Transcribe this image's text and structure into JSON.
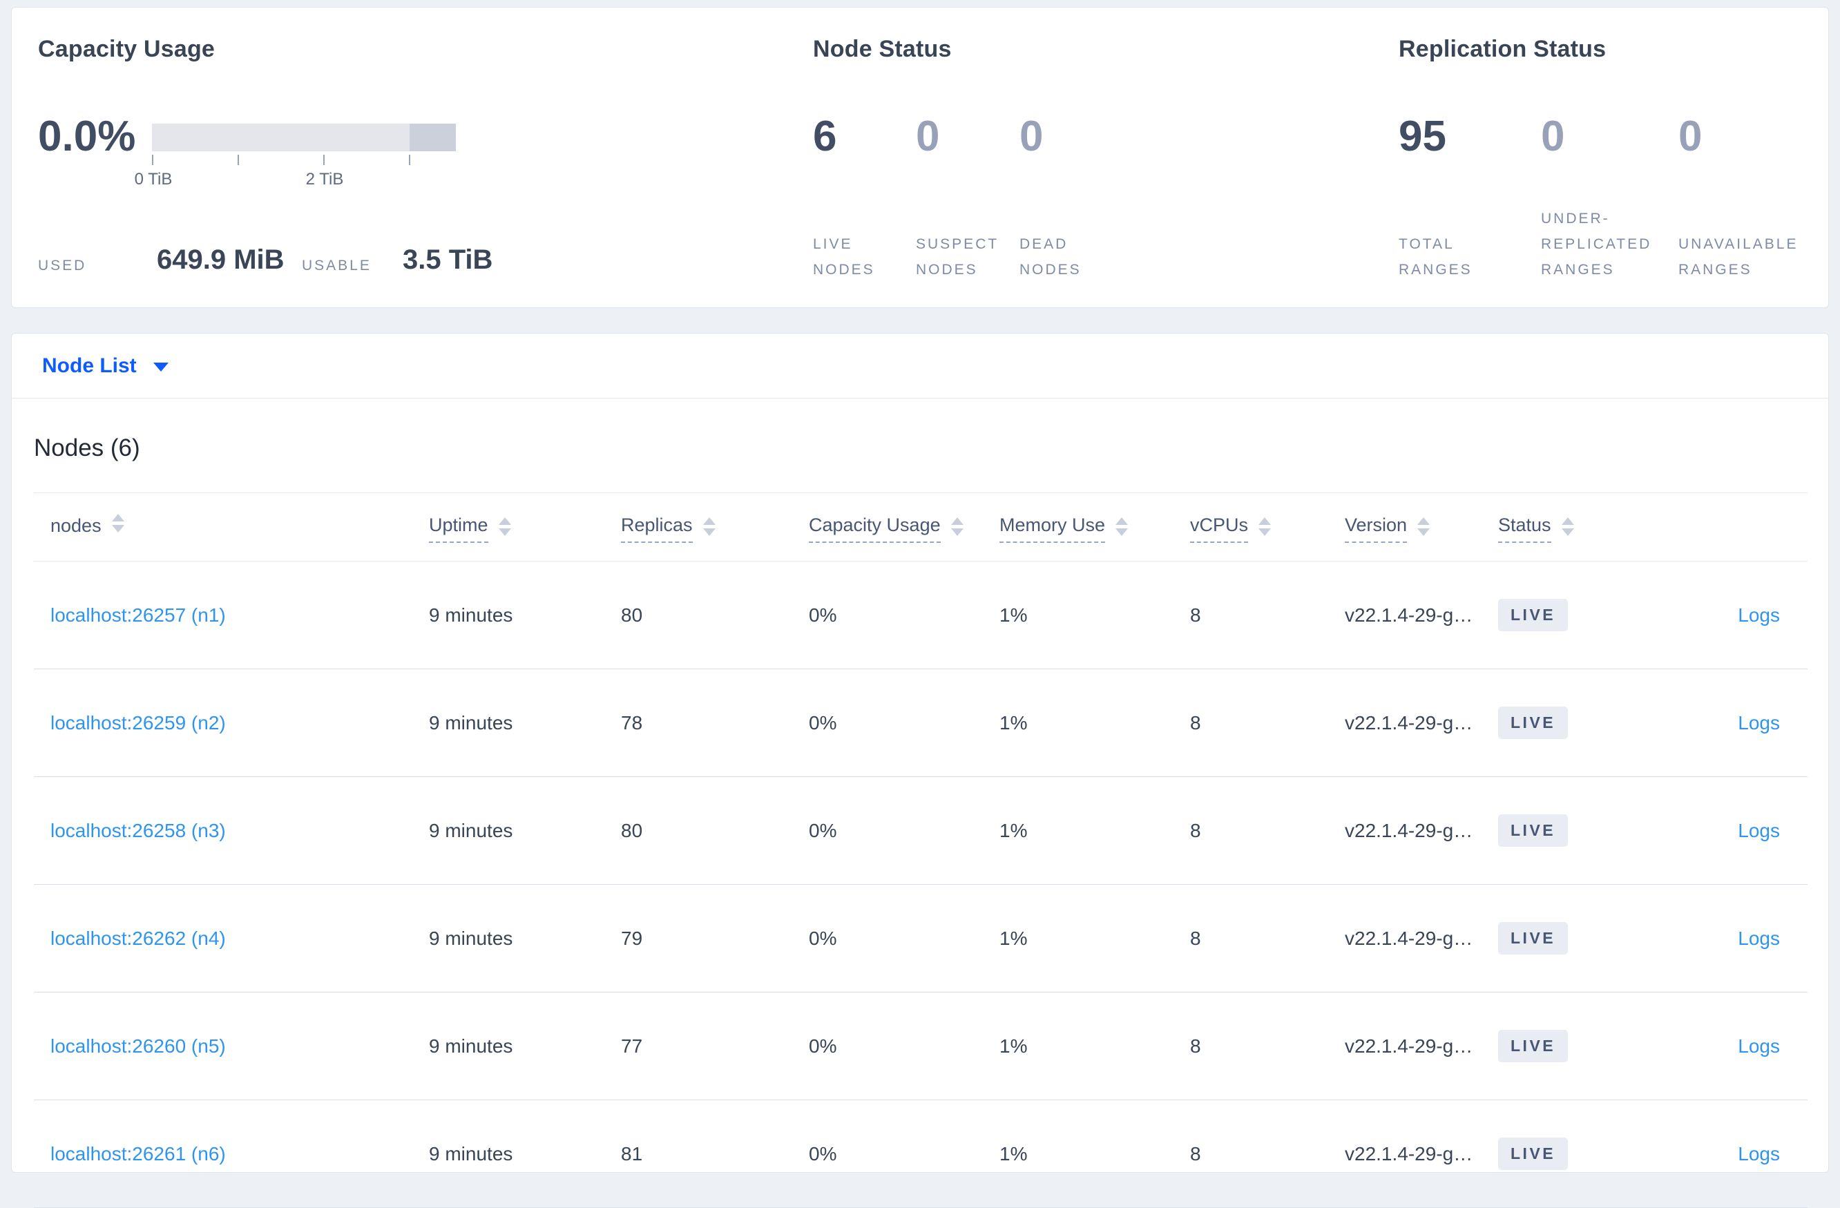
{
  "summary": {
    "capacity": {
      "title": "Capacity Usage",
      "percent": "0.0%",
      "bar": {
        "segments": [
          {
            "name": "usable",
            "fraction": 0.85,
            "color": "#e4e6eb"
          },
          {
            "name": "other",
            "fraction": 0.15,
            "color": "#cbd0db"
          }
        ],
        "tick_labels": [
          "0 TiB",
          "2 TiB"
        ]
      },
      "used_label": "USED",
      "used_value": "649.9 MiB",
      "usable_label": "USABLE",
      "usable_value": "3.5 TiB"
    },
    "node_status": {
      "title": "Node Status",
      "stats": [
        {
          "value": "6",
          "label": "LIVE NODES",
          "emphasis": true
        },
        {
          "value": "0",
          "label": "SUSPECT NODES",
          "emphasis": false
        },
        {
          "value": "0",
          "label": "DEAD NODES",
          "emphasis": false
        }
      ]
    },
    "replication_status": {
      "title": "Replication Status",
      "stats": [
        {
          "value": "95",
          "label": "TOTAL RANGES",
          "emphasis": true
        },
        {
          "value": "0",
          "label": "UNDER-REPLICATED RANGES",
          "emphasis": false
        },
        {
          "value": "0",
          "label": "UNAVAILABLE RANGES",
          "emphasis": false
        }
      ]
    }
  },
  "view_selector": {
    "label": "Node List"
  },
  "nodes_table": {
    "title": "Nodes (6)",
    "columns": [
      "nodes",
      "Uptime",
      "Replicas",
      "Capacity Usage",
      "Memory Use",
      "vCPUs",
      "Version",
      "Status"
    ],
    "rows": [
      {
        "address": "localhost:26257 (n1)",
        "uptime": "9 minutes",
        "replicas": "80",
        "capacity": "0%",
        "memory": "1%",
        "vcpus": "8",
        "version": "v22.1.4-29-g…",
        "status": "LIVE",
        "logs": "Logs"
      },
      {
        "address": "localhost:26259 (n2)",
        "uptime": "9 minutes",
        "replicas": "78",
        "capacity": "0%",
        "memory": "1%",
        "vcpus": "8",
        "version": "v22.1.4-29-g…",
        "status": "LIVE",
        "logs": "Logs"
      },
      {
        "address": "localhost:26258 (n3)",
        "uptime": "9 minutes",
        "replicas": "80",
        "capacity": "0%",
        "memory": "1%",
        "vcpus": "8",
        "version": "v22.1.4-29-g…",
        "status": "LIVE",
        "logs": "Logs"
      },
      {
        "address": "localhost:26262 (n4)",
        "uptime": "9 minutes",
        "replicas": "79",
        "capacity": "0%",
        "memory": "1%",
        "vcpus": "8",
        "version": "v22.1.4-29-g…",
        "status": "LIVE",
        "logs": "Logs"
      },
      {
        "address": "localhost:26260 (n5)",
        "uptime": "9 minutes",
        "replicas": "77",
        "capacity": "0%",
        "memory": "1%",
        "vcpus": "8",
        "version": "v22.1.4-29-g…",
        "status": "LIVE",
        "logs": "Logs"
      },
      {
        "address": "localhost:26261 (n6)",
        "uptime": "9 minutes",
        "replicas": "81",
        "capacity": "0%",
        "memory": "1%",
        "vcpus": "8",
        "version": "v22.1.4-29-g…",
        "status": "LIVE",
        "logs": "Logs"
      }
    ]
  },
  "colors": {
    "page_background": "#edf0f5",
    "card_background": "#ffffff",
    "card_border": "#e0e4eb",
    "primary_text": "#394455",
    "muted_number": "#97a1b7",
    "stat_label": "#7f8aa5",
    "bar_light": "#e4e6eb",
    "bar_dark": "#cbd0db",
    "link_blue": "#0e5cff",
    "sky_link_blue": "#2f94f0",
    "badge_background": "#e9ecf2",
    "row_separator": "#d9dde6"
  }
}
